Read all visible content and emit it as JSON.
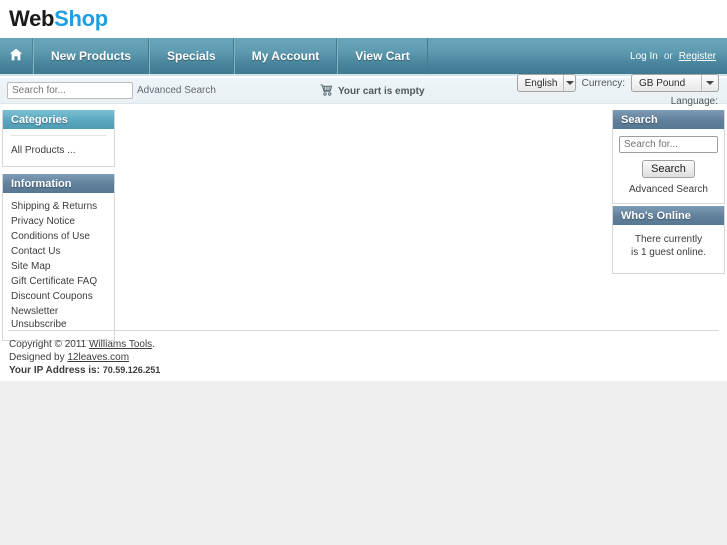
{
  "site": {
    "logo_first": "Web",
    "logo_second": "Shop"
  },
  "nav": {
    "home_icon": "home-icon",
    "items": [
      {
        "label": "New Products"
      },
      {
        "label": "Specials"
      },
      {
        "label": "My Account"
      },
      {
        "label": "View Cart"
      }
    ],
    "auth": {
      "login": "Log In",
      "or": "or",
      "register": "Register"
    }
  },
  "toolbar": {
    "search_placeholder": "Search for...",
    "search_value": "",
    "go_icon": "arrow-right-icon",
    "advanced_search": "Advanced Search",
    "cart_icon": "shopping-cart-icon",
    "cart_status": "Your cart is empty"
  },
  "selectors": {
    "language_value": "English",
    "currency_label": "Currency:",
    "currency_value": "GB Pound",
    "language_label": "Language:",
    "caret_icon": "chevron-down-icon"
  },
  "categories_box": {
    "title": "Categories",
    "links": [
      {
        "label": "All Products ..."
      }
    ]
  },
  "information_box": {
    "title": "Information",
    "links": [
      {
        "label": "Shipping & Returns"
      },
      {
        "label": "Privacy Notice"
      },
      {
        "label": "Conditions of Use"
      },
      {
        "label": "Contact Us"
      },
      {
        "label": "Site Map"
      },
      {
        "label": "Gift Certificate FAQ"
      },
      {
        "label": "Discount Coupons"
      },
      {
        "label": "Newsletter Unsubscribe"
      }
    ]
  },
  "search_box": {
    "title": "Search",
    "input_placeholder": "Search for...",
    "input_value": "",
    "button_label": "Search",
    "advanced_link": "Advanced Search"
  },
  "whos_online_box": {
    "title": "Who's Online",
    "line1": "There currently",
    "line2": "is 1 guest online."
  },
  "footer": {
    "copyright_prefix": "Copyright © 2011",
    "copyright_link": "Williams Tools",
    "copyright_suffix": ".",
    "designed_prefix": "Designed by",
    "designed_link": "12leaves.com",
    "ip_label": "Your IP Address is:",
    "ip_value": "70.59.126.251"
  },
  "colors": {
    "brand_blue": "#1d9fe0",
    "nav_teal": "#5f9cb1",
    "box_teal": "#59a6bd",
    "box_steel": "#5f7f9b",
    "page_bg": "#efeff0"
  }
}
